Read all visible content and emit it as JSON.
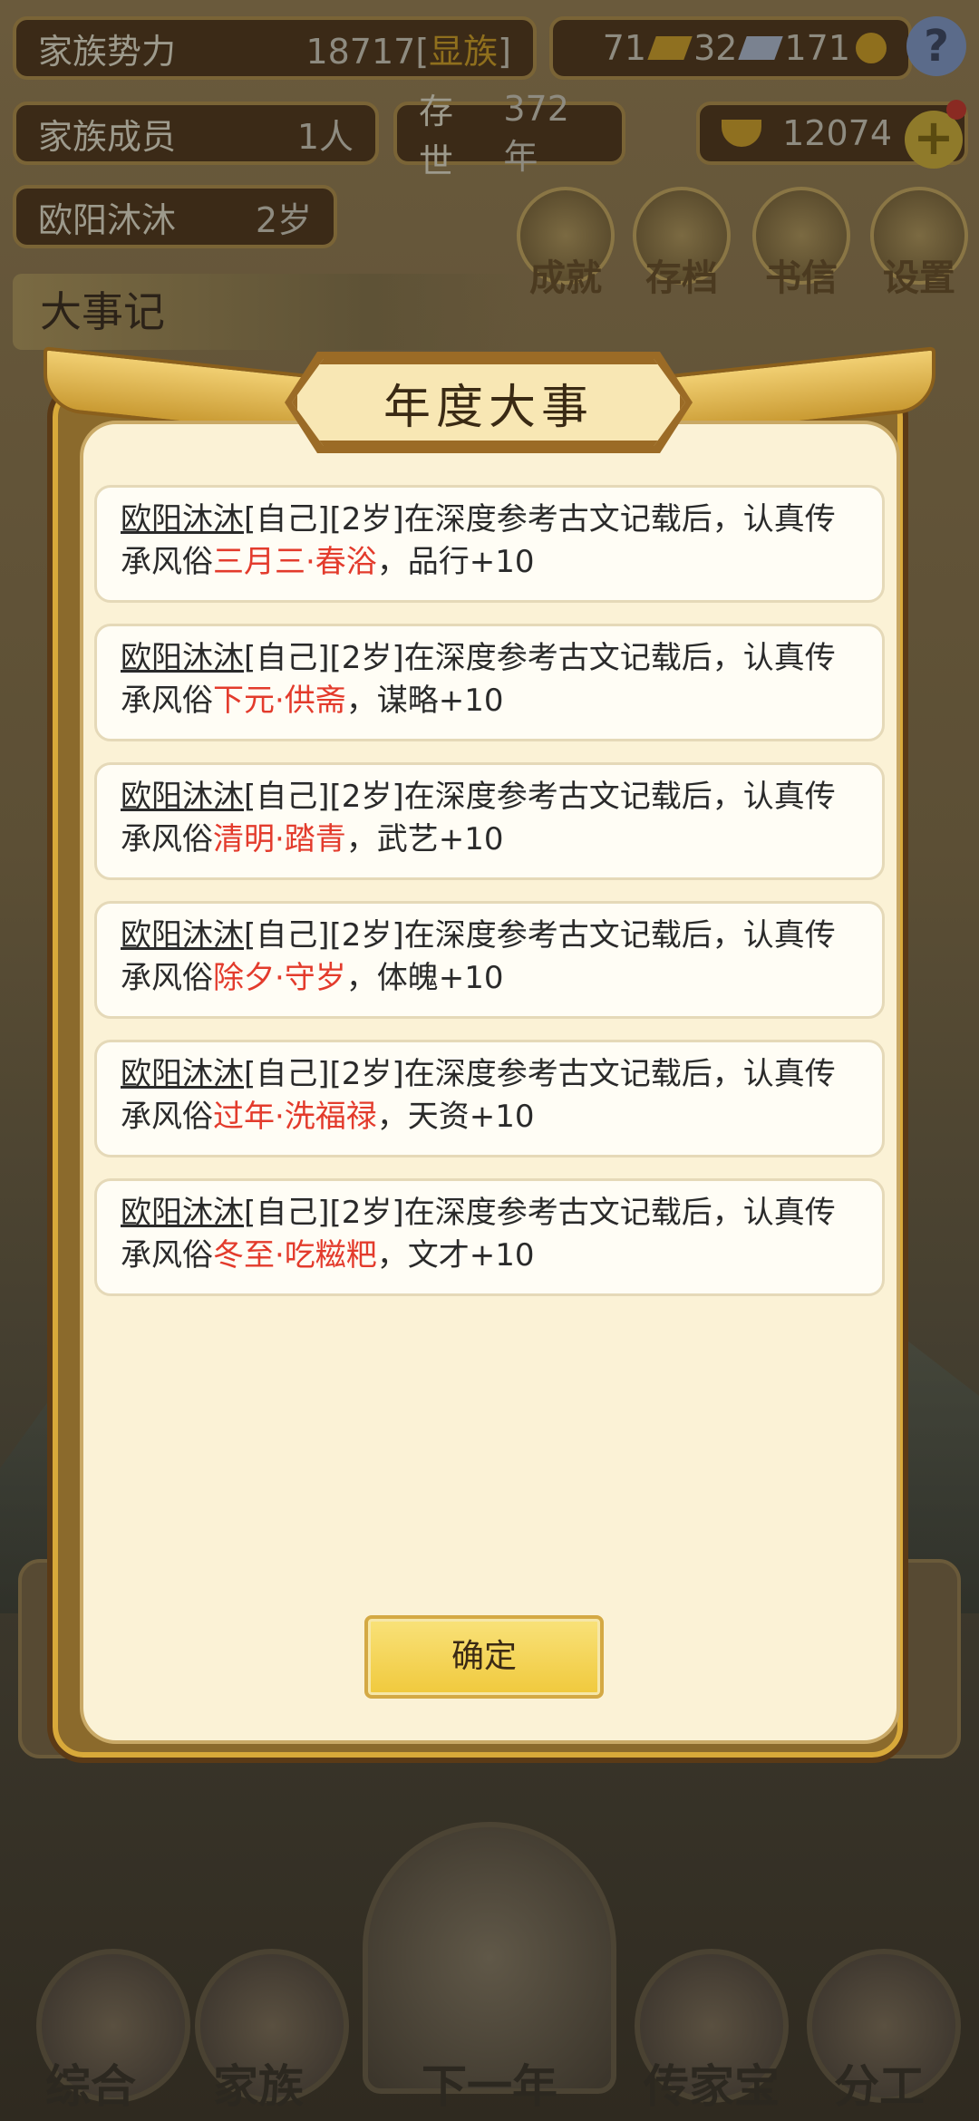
{
  "header": {
    "clan_power_label": "家族势力",
    "clan_power_value": "18717",
    "clan_rank": "显族",
    "gold_bars": "71",
    "silver_bars": "32",
    "coins": "171",
    "members_label": "家族成员",
    "members_value": "1人",
    "existence_label": "存世",
    "existence_value": "372年",
    "ingots": "12074",
    "character_name": "欧阳沐沐",
    "character_age": "2岁"
  },
  "top_buttons": [
    {
      "label": "成就",
      "icon": "achievement-icon"
    },
    {
      "label": "存档",
      "icon": "archive-icon"
    },
    {
      "label": "书信",
      "icon": "letter-icon"
    },
    {
      "label": "设置",
      "icon": "settings-icon"
    }
  ],
  "chronicle_title": "大事记",
  "modal": {
    "title": "年度大事",
    "events": [
      {
        "name": "欧阳沐沐",
        "prefix": "[自己][2岁]在深度参考古文记载后，认真传承风俗",
        "custom": "三月三·春浴",
        "reward": "，品行+10"
      },
      {
        "name": "欧阳沐沐",
        "prefix": "[自己][2岁]在深度参考古文记载后，认真传承风俗",
        "custom": "下元·供斋",
        "reward": "，谋略+10"
      },
      {
        "name": "欧阳沐沐",
        "prefix": "[自己][2岁]在深度参考古文记载后，认真传承风俗",
        "custom": "清明·踏青",
        "reward": "，武艺+10"
      },
      {
        "name": "欧阳沐沐",
        "prefix": "[自己][2岁]在深度参考古文记载后，认真传承风俗",
        "custom": "除夕·守岁",
        "reward": "，体魄+10"
      },
      {
        "name": "欧阳沐沐",
        "prefix": "[自己][2岁]在深度参考古文记载后，认真传承风俗",
        "custom": "过年·洗福禄",
        "reward": "，天资+10"
      },
      {
        "name": "欧阳沐沐",
        "prefix": "[自己][2岁]在深度参考古文记载后，认真传承风俗",
        "custom": "冬至·吃糍粑",
        "reward": "，文才+10"
      }
    ],
    "confirm_label": "确定"
  },
  "bottom_nav": [
    {
      "label": "综合",
      "icon": "scroll-icon"
    },
    {
      "label": "家族",
      "icon": "house-icon"
    },
    {
      "label": "下一年",
      "icon": "mountain-icon"
    },
    {
      "label": "传家宝",
      "icon": "treasure-icon"
    },
    {
      "label": "分工",
      "icon": "people-icon"
    }
  ],
  "colors": {
    "custom_highlight": "#e33b2c",
    "modal_background": "#fbf2d6",
    "frame_gold": "#d8a93a",
    "confirm_button": "#f0c93c"
  }
}
